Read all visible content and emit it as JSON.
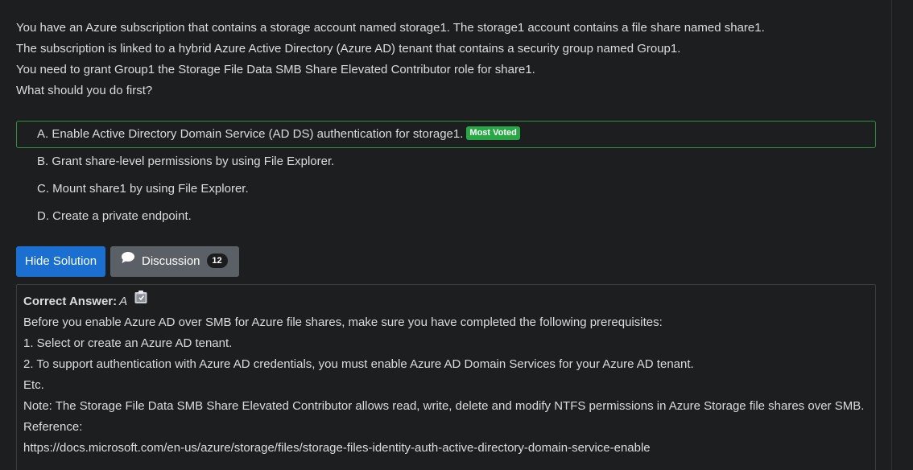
{
  "question": {
    "lines": [
      "You have an Azure subscription that contains a storage account named storage1. The storage1 account contains a file share named share1.",
      "The subscription is linked to a hybrid Azure Active Directory (Azure AD) tenant that contains a security group named Group1.",
      "You need to grant Group1 the Storage File Data SMB Share Elevated Contributor role for share1.",
      "What should you do first?"
    ]
  },
  "choices": [
    {
      "text": "A. Enable Active Directory Domain Service (AD DS) authentication for storage1.",
      "badge": "Most Voted"
    },
    {
      "text": "B. Grant share-level permissions by using File Explorer."
    },
    {
      "text": "C. Mount share1 by using File Explorer."
    },
    {
      "text": "D. Create a private endpoint."
    }
  ],
  "buttons": {
    "hide_solution": "Hide Solution",
    "discussion": "Discussion",
    "discussion_count": "12"
  },
  "icons": {
    "discussion": "chat-bubble-icon",
    "answer": "clipboard-icon"
  },
  "answer": {
    "label": "Correct Answer:",
    "value": "A",
    "lines": [
      "Before you enable Azure AD over SMB for Azure file shares, make sure you have completed the following prerequisites:",
      "1. Select or create an Azure AD tenant.",
      "2. To support authentication with Azure AD credentials, you must enable Azure AD Domain Services for your Azure AD tenant.",
      "Etc.",
      "Note: The Storage File Data SMB Share Elevated Contributor allows read, write, delete and modify NTFS permissions in Azure Storage file shares over SMB.",
      "Reference:",
      "https://docs.microsoft.com/en-us/azure/storage/files/storage-files-identity-auth-active-directory-domain-service-enable"
    ]
  },
  "colors": {
    "background": "#1d1e20",
    "primary_button": "#1a6fd1",
    "secondary_button": "#5b6066",
    "voted_border": "#2f8f3a",
    "badge": "#28a745"
  }
}
